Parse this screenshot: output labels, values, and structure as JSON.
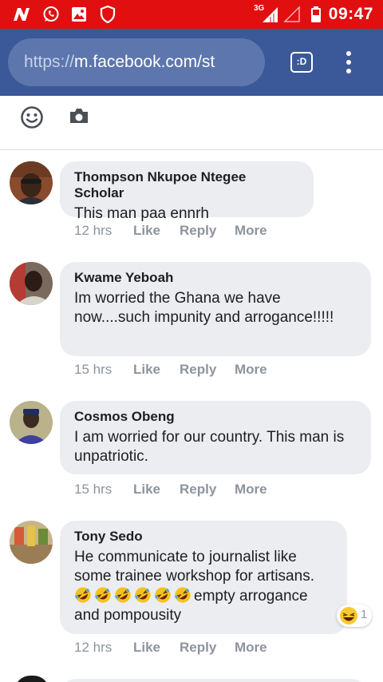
{
  "status_bar": {
    "time": "09:47",
    "network": "3G",
    "icons": [
      "n-logo-icon",
      "whatsapp-icon",
      "gallery-icon",
      "shield-icon",
      "signal-icon",
      "battery-icon"
    ]
  },
  "browser": {
    "url_scheme": "https://",
    "url_host": "m.facebook.com/st",
    "tabs_label": ":D",
    "menu_icon": "overflow-menu-icon"
  },
  "composer": {
    "icons": [
      "emoji-icon",
      "camera-icon"
    ]
  },
  "action_labels": {
    "like": "Like",
    "reply": "Reply",
    "more": "More"
  },
  "comments": [
    {
      "author": "Thompson Nkupoe Ntegee Scholar",
      "text": "This man paa ennrh",
      "time": "12 hrs"
    },
    {
      "author": "Kwame Yeboah",
      "text": "Im worried the Ghana we have now....such impunity and arrogance!!!!!",
      "time": "15 hrs"
    },
    {
      "author": "Cosmos Obeng",
      "text": "I am worried for our country. This man is unpatriotic.",
      "time": "15 hrs"
    },
    {
      "author": "Tony Sedo",
      "text_before": "He communicate to journalist like some trainee workshop for artisans. ",
      "text_after": "empty arrogance and pompousity",
      "emoji_count": 6,
      "time": "12 hrs",
      "reaction_count": "1",
      "reaction_icon": "laughing-reaction-icon"
    }
  ],
  "colors": {
    "status_bar": "#e10f0f",
    "browser_bar": "#3b5998",
    "bubble": "#ebedf0",
    "meta_text": "#8d949e"
  }
}
